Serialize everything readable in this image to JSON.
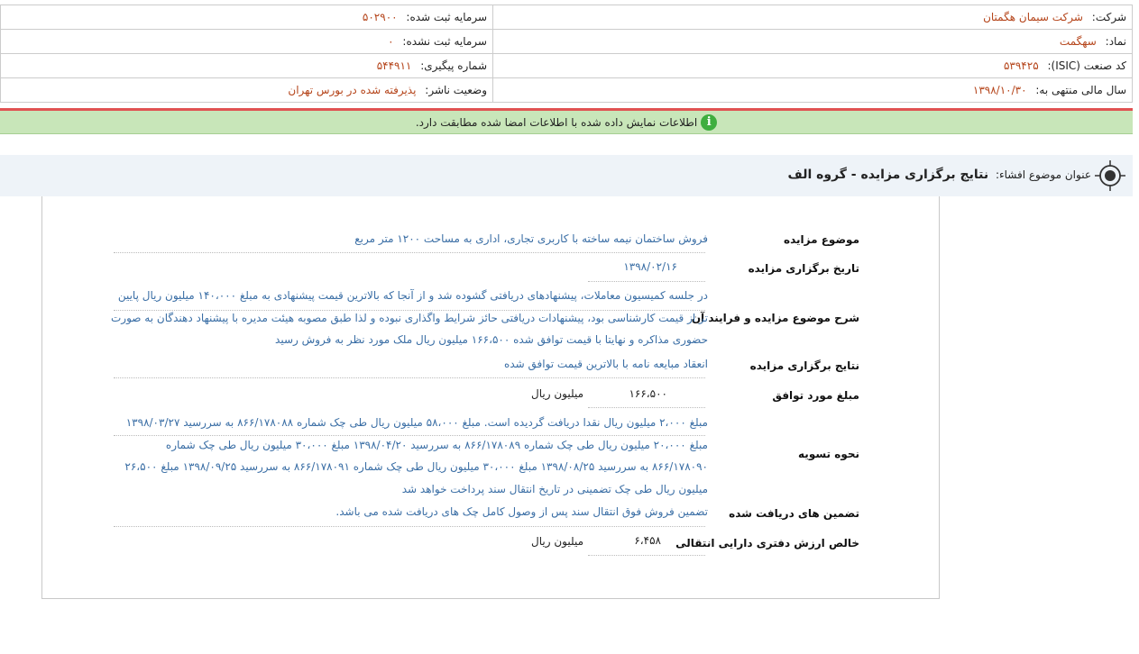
{
  "header": {
    "company_label": "شرکت:",
    "company_value": "شرکت سیمان هگمتان",
    "symbol_label": "نماد:",
    "symbol_value": "سهگمت",
    "isic_label": "کد صنعت (ISIC):",
    "isic_value": "۵۳۹۴۲۵",
    "fiscal_label": "سال مالی منتهی به:",
    "fiscal_value": "۱۳۹۸/۱۰/۳۰",
    "reg_capital_label": "سرمایه ثبت شده:",
    "reg_capital_value": "۵۰۲۹۰۰",
    "unreg_capital_label": "سرمایه ثبت نشده:",
    "unreg_capital_value": "۰",
    "tracking_label": "شماره پیگیری:",
    "tracking_value": "۵۴۴۹۱۱",
    "publisher_label": "وضعیت ناشر:",
    "publisher_value": "پذیرفته شده در بورس تهران"
  },
  "notice": {
    "icon": "info-icon",
    "text": "اطلاعات نمایش داده شده با اطلاعات امضا شده مطابقت دارد."
  },
  "title": {
    "icon": "target-icon",
    "label": "عنوان موضوع افشاء:",
    "value": "نتایج برگزاری مزایده - گروه الف"
  },
  "fields": {
    "subject_label": "موضوع مزایده",
    "subject_value": "فروش ساختمان نیمه ساخته با کاربری تجاری، اداری به مساحت ۱۲۰۰ متر مربع",
    "date_label": "تاریخ برگزاری مزایده",
    "date_value": "۱۳۹۸/۰۲/۱۶",
    "desc_label": "شرح موضوع مزایده و فرایند آن",
    "desc_value": "در جلسه کمیسیون معاملات، پیشنهادهای دریافتی گشوده شد و از آنجا که بالاترین قیمت پیشنهادی به مبلغ ۱۴۰،۰۰۰ میلیون ریال پایین تر از قیمت کارشناسی بود، پیشنهادات دریافتی حائز شرایط واگذاری نبوده و لذا طبق مصوبه هیئت مدیره با پیشنهاد دهندگان به صورت حضوری مذاکره و نهایتا با قیمت توافق شده ۱۶۶،۵۰۰ میلیون ریال ملک مورد نظر به فروش رسید",
    "result_label": "نتایج برگزاری مزایده",
    "result_value": "انعقاد مبایعه نامه با بالاترین قیمت توافق شده",
    "amount_label": "مبلغ مورد توافق",
    "amount_value": "۱۶۶،۵۰۰",
    "amount_unit": "میلیون ریال",
    "settlement_label": "نحوه تسویه",
    "settlement_value": "مبلغ ۲،۰۰۰ میلیون ریال نقدا دریافت گردیده است. مبلغ ۵۸،۰۰۰ میلیون ریال طی چک شماره ۸۶۶/۱۷۸۰۸۸ به سررسید ۱۳۹۸/۰۳/۲۷ مبلغ ۲۰،۰۰۰ میلیون ریال طی چک شماره ۸۶۶/۱۷۸۰۸۹ به سررسید ۱۳۹۸/۰۴/۲۰ مبلغ ۳۰،۰۰۰ میلیون ریال طی چک شماره ۸۶۶/۱۷۸۰۹۰ به سررسید ۱۳۹۸/۰۸/۲۵ مبلغ ۳۰،۰۰۰ میلیون ریال طی چک شماره ۸۶۶/۱۷۸۰۹۱ به سررسید ۱۳۹۸/۰۹/۲۵ مبلغ ۲۶،۵۰۰ میلیون ریال طی چک تضمینی در تاریخ انتقال سند پرداخت خواهد شد",
    "guarantee_label": "تضمین های دریافت شده",
    "guarantee_value": "تضمین فروش فوق انتقال سند پس از وصول کامل چک های دریافت شده می باشد.",
    "book_label": "خالص ارزش دفتری دارایی انتقالی",
    "book_value": "۶،۴۵۸",
    "book_unit": "میلیون ریال"
  }
}
